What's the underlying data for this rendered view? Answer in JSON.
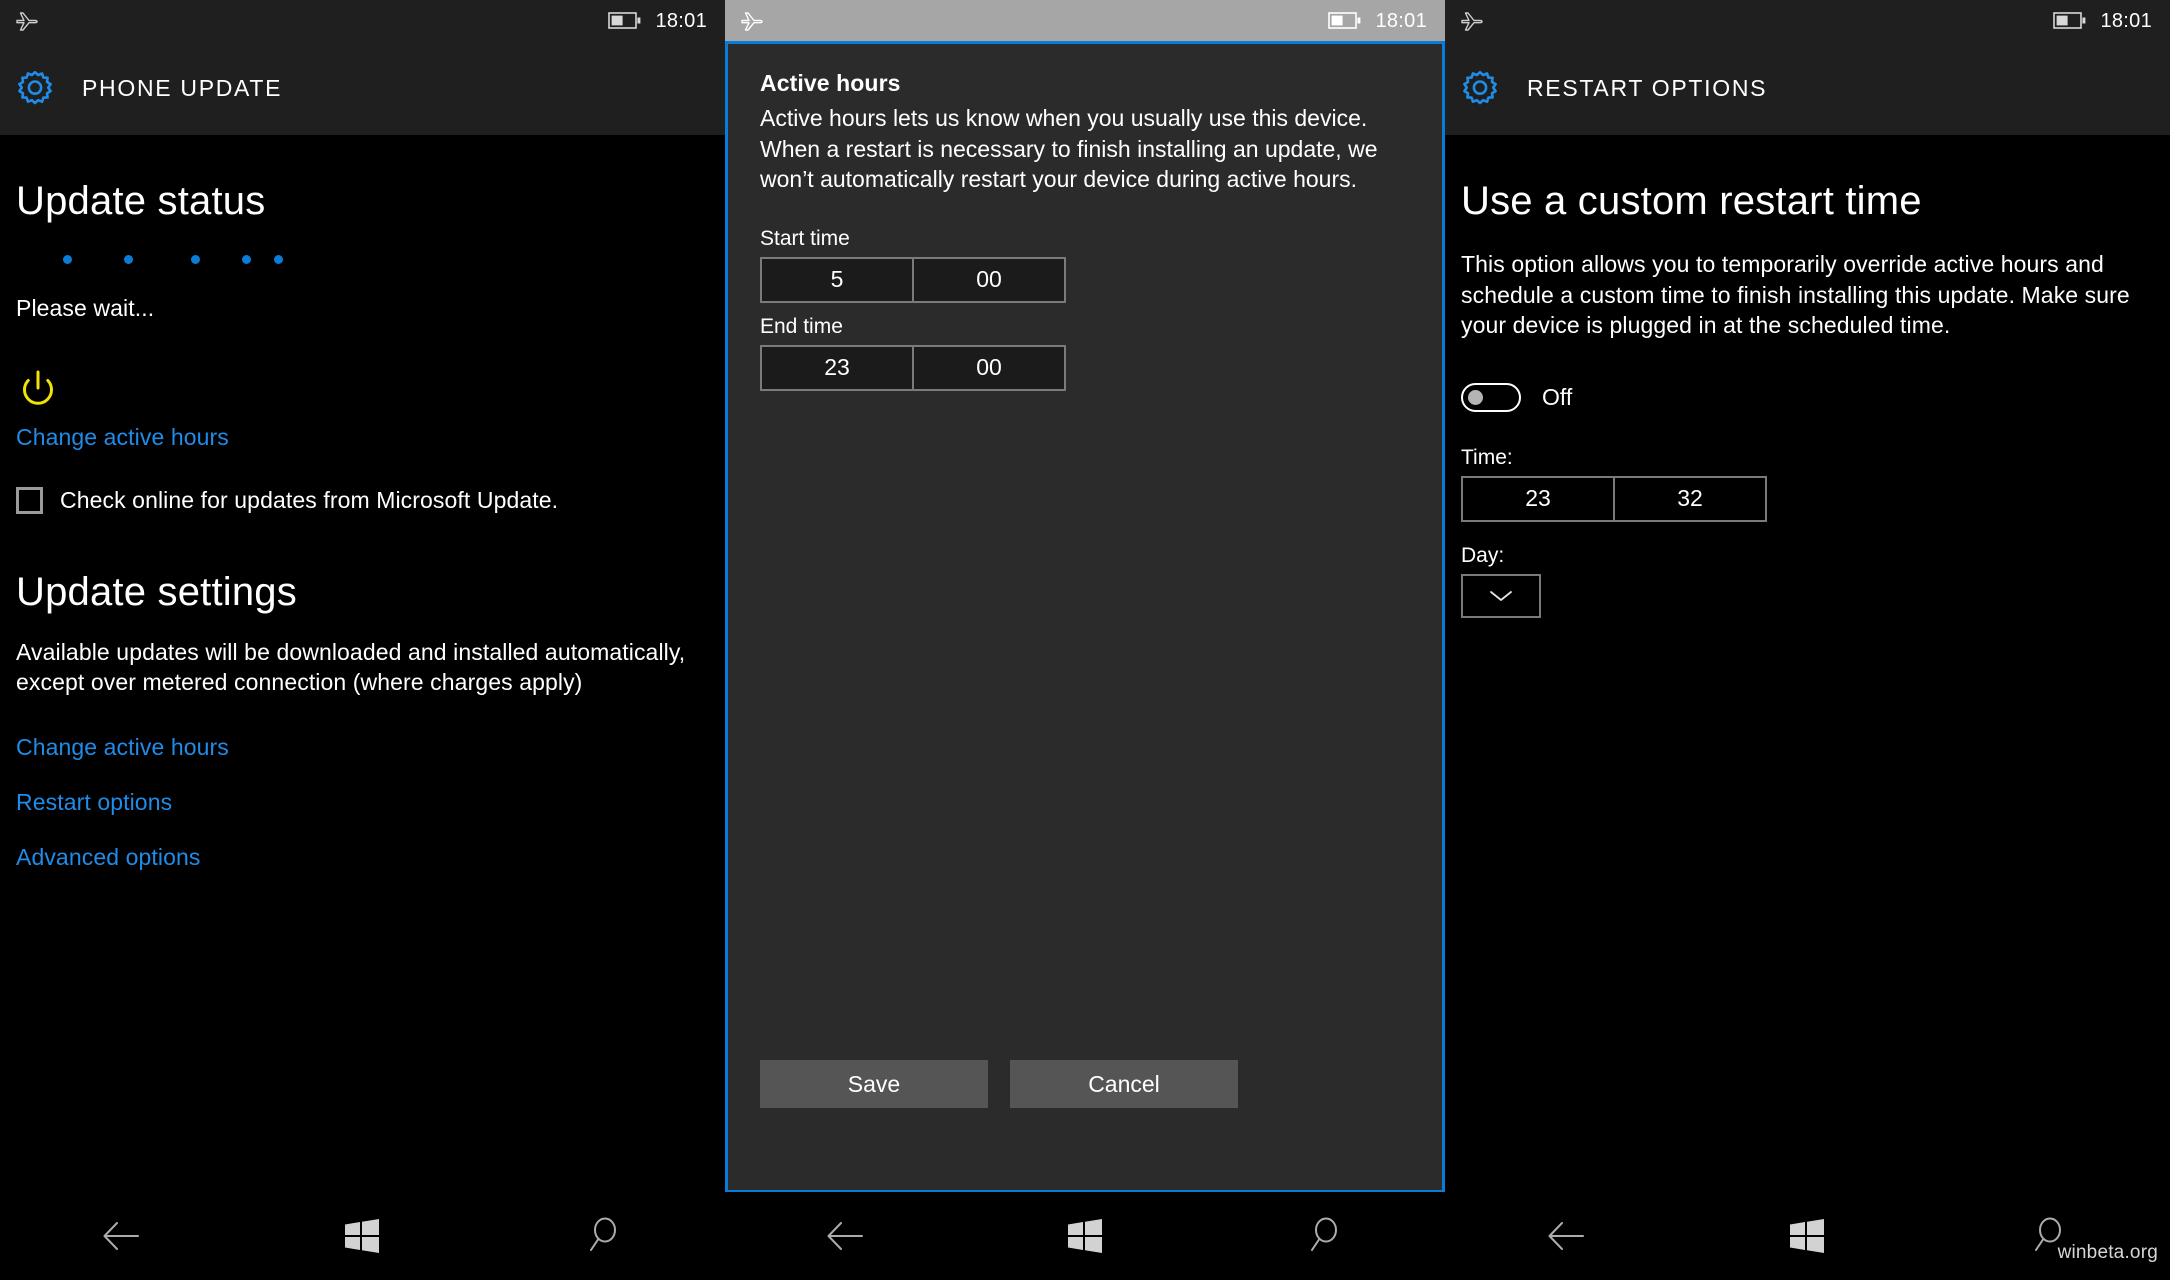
{
  "statusbar": {
    "time": "18:01",
    "airplane_icon": "airplane-mode-icon",
    "battery_icon": "battery-icon"
  },
  "panel_left": {
    "header": {
      "icon": "settings-gear-icon",
      "title": "PHONE UPDATE"
    },
    "update_status": {
      "heading": "Update status",
      "progress_dots": 5,
      "status_text": "Please wait...",
      "power_icon": "power-icon",
      "change_active_hours_link": "Change active hours",
      "checkbox": {
        "label": "Check online for updates from Microsoft Update.",
        "checked": false
      }
    },
    "update_settings": {
      "heading": "Update settings",
      "description": "Available updates will be downloaded and installed automatically, except over metered connection (where charges apply)",
      "links": [
        "Change active hours",
        "Restart options",
        "Advanced options"
      ]
    },
    "navbar": {
      "back": "back-icon",
      "home": "windows-icon",
      "search": "search-icon"
    }
  },
  "panel_mid": {
    "dialog": {
      "title": "Active hours",
      "description": "Active hours lets us know when you usually use this device. When a restart is necessary to finish installing an update, we won’t automatically restart your device during active hours.",
      "start_time": {
        "label": "Start time",
        "hour": "5",
        "minute": "00"
      },
      "end_time": {
        "label": "End time",
        "hour": "23",
        "minute": "00"
      },
      "save_label": "Save",
      "cancel_label": "Cancel",
      "border_color": "#0a7cd8"
    },
    "navbar": {
      "back": "back-icon",
      "home": "windows-icon",
      "search": "search-icon"
    }
  },
  "panel_right": {
    "header": {
      "icon": "settings-gear-icon",
      "title": "RESTART OPTIONS"
    },
    "heading": "Use a custom restart time",
    "description": "This option allows you to temporarily override active hours and schedule a custom time to finish installing this update. Make sure your device is plugged in at the scheduled time.",
    "toggle": {
      "state_label": "Off",
      "on": false
    },
    "time": {
      "label": "Time:",
      "hour": "23",
      "minute": "32"
    },
    "day": {
      "label": "Day:",
      "value": "",
      "chevron_icon": "chevron-down-icon"
    },
    "navbar": {
      "back": "back-icon",
      "home": "windows-icon",
      "search": "search-icon"
    }
  },
  "watermark": "winbeta.org",
  "colors": {
    "accent_blue": "#0a7cd8",
    "link_blue": "#1f8ce8",
    "power_yellow": "#f2e205",
    "header_bg": "#1f1f1f",
    "dialog_bg": "#2b2b2b",
    "status_gray": "#a6a6a6"
  }
}
